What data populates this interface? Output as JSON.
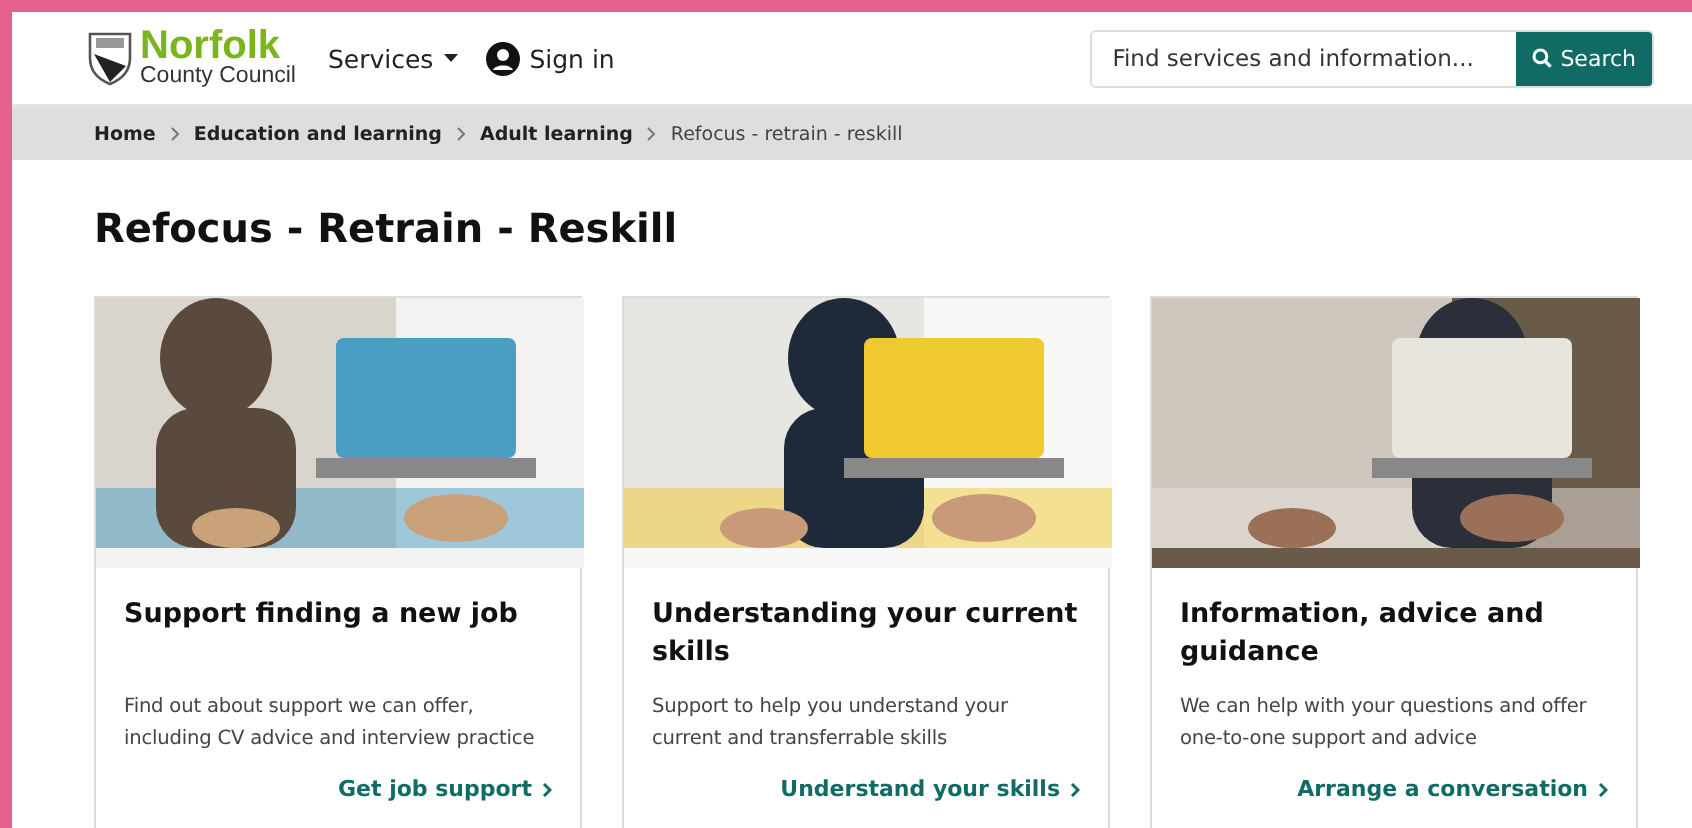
{
  "header": {
    "logo": {
      "name": "Norfolk",
      "subtitle": "County Council"
    },
    "nav": [
      {
        "label": "Services",
        "kind": "dropdown"
      },
      {
        "label": "Sign in",
        "kind": "account"
      }
    ],
    "search": {
      "placeholder": "Find services and information...",
      "button": "Search"
    }
  },
  "breadcrumb": [
    {
      "label": "Home",
      "current": false
    },
    {
      "label": "Education and learning",
      "current": false
    },
    {
      "label": "Adult learning",
      "current": false
    },
    {
      "label": "Refocus - retrain - reskill",
      "current": true
    }
  ],
  "title": "Refocus - Retrain - Reskill",
  "cards": [
    {
      "heading": "Support finding a new job",
      "text": "Find out about support we can offer, including CV advice and interview practice",
      "link": "Get job support"
    },
    {
      "heading": "Understanding your current skills",
      "text": "Support to help you understand your current and transferrable skills",
      "link": "Understand your skills"
    },
    {
      "heading": "Information, advice and guidance",
      "text": "We can help with your questions and offer one-to-one support and advice",
      "link": "Arrange a conversation"
    }
  ]
}
